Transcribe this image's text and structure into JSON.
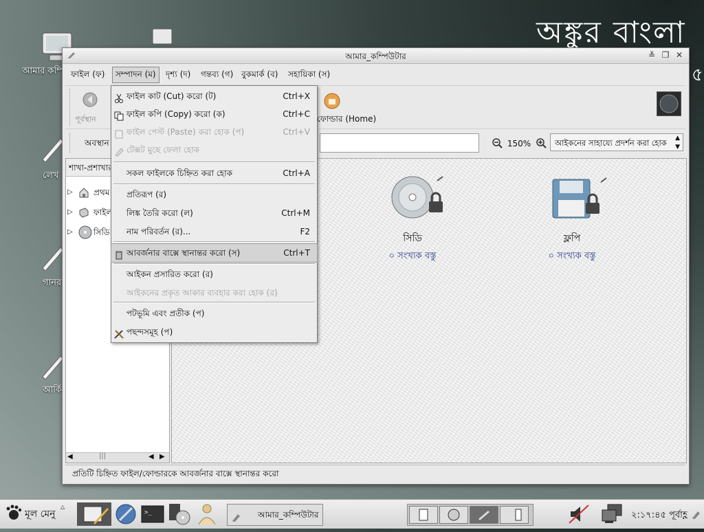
{
  "desktop": {
    "brand_text": "অঙ্কুর বাংলা",
    "edge_glyph": "৫",
    "icons": [
      {
        "label": "আমার কম্পিউটার"
      },
      {
        "label": "লেখ"
      },
      {
        "label": "গানর"
      },
      {
        "label": "আর্কি"
      }
    ]
  },
  "window": {
    "title": "আমার_কম্পিউটার",
    "controls": {
      "shade": "≚",
      "maximize": "❐",
      "close": "✕"
    },
    "menubar": [
      "ফাইল (ফ)",
      "সম্পাদন (ম)",
      "দৃশ্য (দ)",
      "গন্তব্য (গ)",
      "বুকমার্ক (ব)",
      "সহায়িকা (স)"
    ],
    "toolbar": {
      "back_label": "পূর্বস্থান",
      "home_label": "ফোল্ডার (Home)"
    },
    "location": {
      "label": "অবস্থান",
      "zoom_value": "150%",
      "view_mode": "আইকনের সাহায্যে প্রদর্শন করা হোক"
    },
    "sidebar": {
      "header": "শাখা-প্রশাখার",
      "items": [
        {
          "label": "প্রথম"
        },
        {
          "label": "ফাইল"
        },
        {
          "label": "সিডি"
        }
      ],
      "scroll_thumb": "|||"
    },
    "files": [
      {
        "name": "সিডি",
        "info": "০ সংখ্যক বস্তু",
        "icon": "cd-icon"
      },
      {
        "name": "ফ্লপি",
        "info": "০ সংখ্যক বস্তু",
        "icon": "floppy-icon"
      }
    ],
    "status": "প্রতিটি চিহ্নিত ফাইল/ফোল্ডারকে আবর্জনার বাক্সে স্থানান্তর করো"
  },
  "edit_menu": {
    "items": [
      {
        "label": "ফাইল কাট (Cut) করো (ট)",
        "shortcut": "Ctrl+X",
        "icon": "cut-icon",
        "enabled": true
      },
      {
        "label": "ফাইল কপি (Copy) করো (ক)",
        "shortcut": "Ctrl+C",
        "icon": "copy-icon",
        "enabled": true
      },
      {
        "label": "ফাইল পেস্ট (Paste) করা হোক (প)",
        "shortcut": "Ctrl+V",
        "icon": "paste-icon",
        "enabled": false
      },
      {
        "label": "টেক্সট মুছে ফেলা হোক",
        "shortcut": "",
        "icon": "clear-icon",
        "enabled": false
      },
      {
        "label": "সকল ফাইলকে চিহ্নিত করা হোক",
        "shortcut": "Ctrl+A",
        "enabled": true
      },
      {
        "label": "প্রতিরূপ (র)",
        "shortcut": "",
        "enabled": true
      },
      {
        "label": "লিঙ্ক তৈরি করো (ল)",
        "shortcut": "Ctrl+M",
        "enabled": true
      },
      {
        "label": "নাম পরিবর্তন (র)...",
        "shortcut": "F2",
        "enabled": true
      },
      {
        "label": "আবর্জনার বাক্সে স্থানান্তর করো (স)",
        "shortcut": "Ctrl+T",
        "icon": "trash-icon",
        "enabled": true
      },
      {
        "label": "আইকন প্রসারিত করো (র)",
        "shortcut": "",
        "enabled": true
      },
      {
        "label": "আইকনের প্রকৃত আকার ব্যবহার করা হোক (র)",
        "shortcut": "",
        "enabled": false
      },
      {
        "label": "পটভূমি এবং প্রতীক (প)",
        "shortcut": "",
        "enabled": true
      },
      {
        "label": "পছন্দসমূহ (প)",
        "shortcut": "",
        "icon": "preferences-icon",
        "enabled": true
      }
    ]
  },
  "taskbar": {
    "start_label": "মূল মেনু",
    "task_label": "আমার_কম্পিউটার",
    "clock": "২:১৭:৪৫ পূর্বাহ্ণ"
  }
}
